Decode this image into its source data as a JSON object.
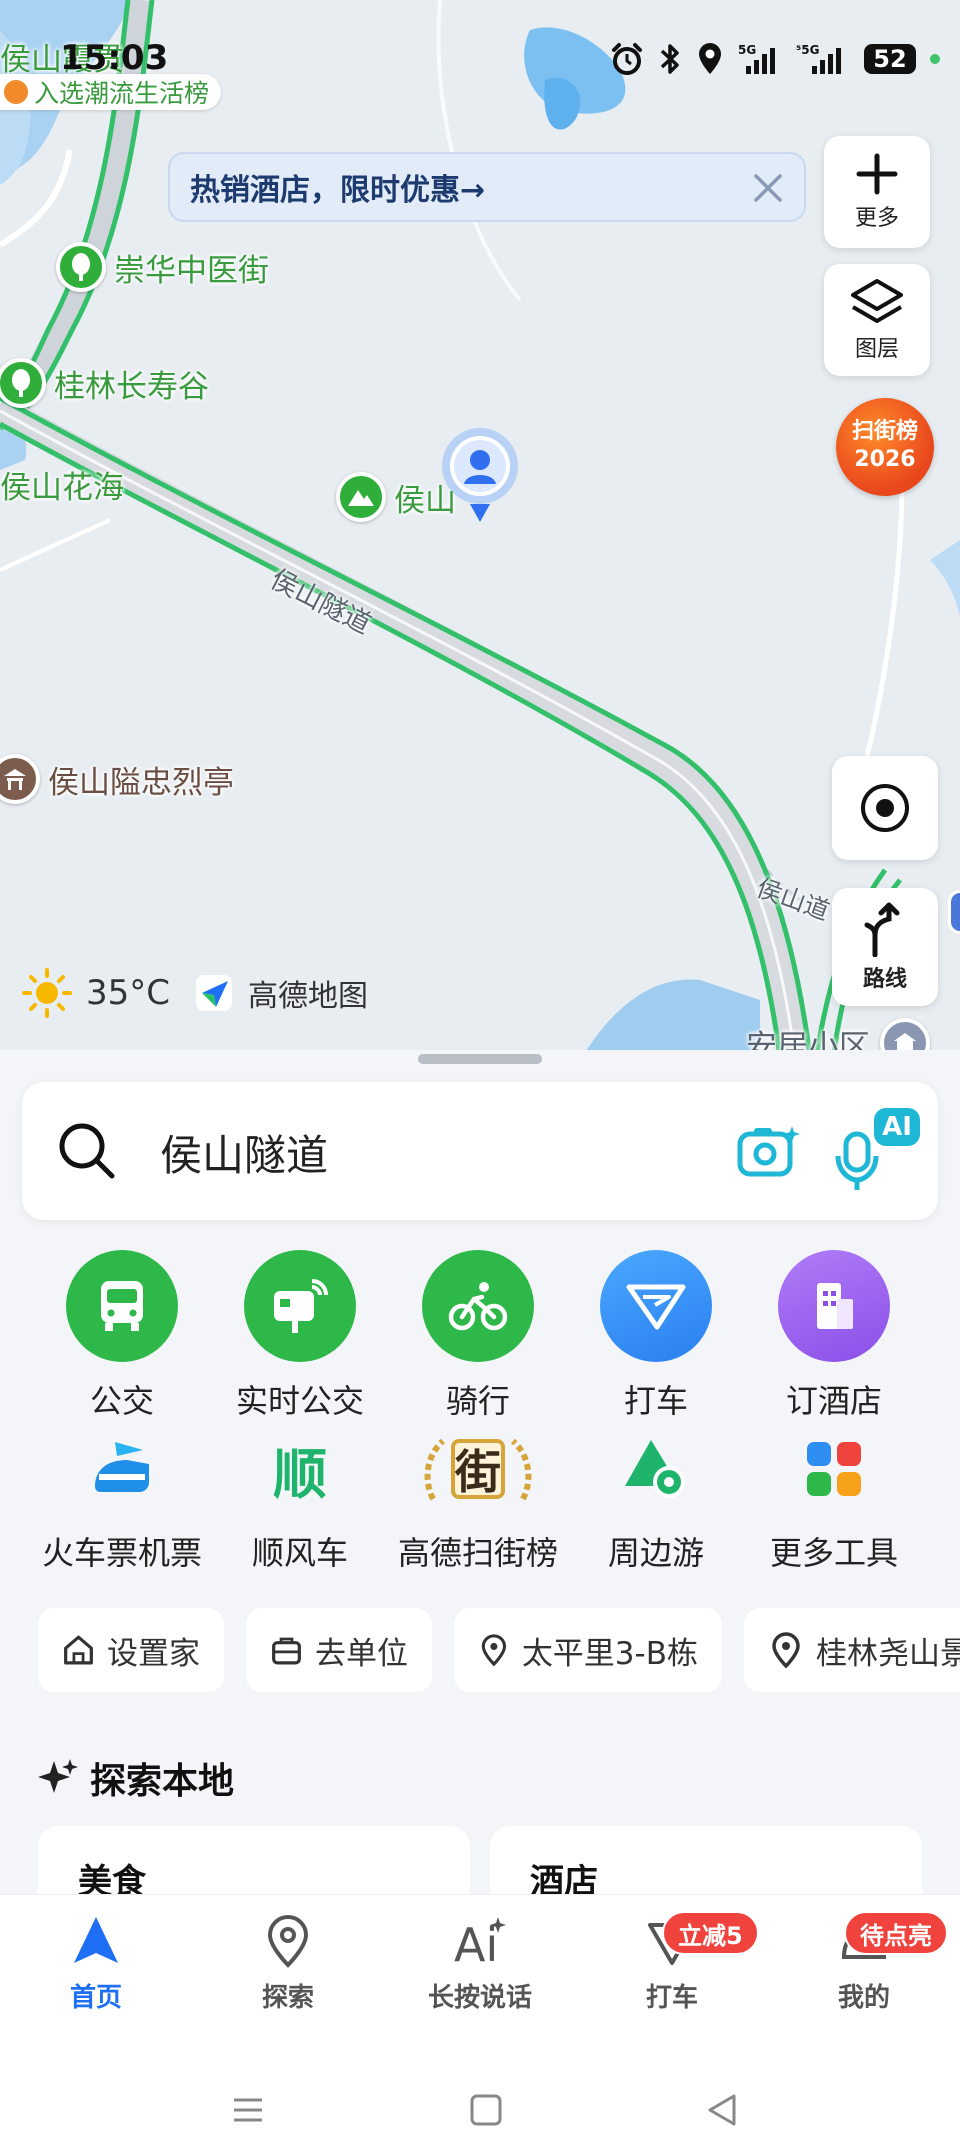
{
  "status_bar": {
    "time": "15:03",
    "battery": "52",
    "network": [
      "5G",
      "5G"
    ]
  },
  "map": {
    "labels": {
      "top_left_poi": "侯山霞贯",
      "trend_list": "入选潮流生活榜",
      "chonghua": "崇华中医街",
      "guilin_changshou": "桂林长寿谷",
      "houshan_huahai": "侯山花海",
      "houshan": "侯山",
      "tunnel_road": "侯山隧道",
      "martyrs_pavilion": "侯山隘忠烈亭",
      "houshan_road": "侯山道",
      "anju_community": "安居小区"
    },
    "promo_text": "热销酒店，限时优惠→",
    "more_button": "更多",
    "layers_button": "图层",
    "rank_badge": [
      "扫街榜",
      "2026"
    ],
    "route_button": "路线",
    "weather_temp": "35°C",
    "brand": "高德地图"
  },
  "search": {
    "query": "侯山隧道",
    "ai_badge": "AI"
  },
  "tools_row1": [
    {
      "label": "公交",
      "color": "#2fb84a"
    },
    {
      "label": "实时公交",
      "color": "#2fb84a"
    },
    {
      "label": "骑行",
      "color": "#2fb84a"
    },
    {
      "label": "打车",
      "color": "#2f8ef2"
    },
    {
      "label": "订酒店",
      "color": "#9a5ff0"
    }
  ],
  "tools_row2": [
    {
      "label": "火车票机票"
    },
    {
      "label": "顺风车",
      "glyph": "顺"
    },
    {
      "label": "高德扫街榜",
      "glyph": "街"
    },
    {
      "label": "周边游"
    },
    {
      "label": "更多工具"
    }
  ],
  "chips": [
    {
      "label": "设置家",
      "icon": "home-icon"
    },
    {
      "label": "去单位",
      "icon": "briefcase-icon"
    },
    {
      "label": "太平里3-B栋",
      "icon": "location-pin-icon"
    },
    {
      "label": "桂林尧山景",
      "icon": "location-pin-icon"
    }
  ],
  "explore": {
    "title": "探索本地",
    "cards": [
      "美食",
      "酒店"
    ]
  },
  "bottom_nav": {
    "items": [
      {
        "label": "首页"
      },
      {
        "label": "探索"
      },
      {
        "label": "长按说话"
      },
      {
        "label": "打车",
        "badge": "立减5"
      },
      {
        "label": "我的",
        "badge": "待点亮"
      }
    ]
  }
}
